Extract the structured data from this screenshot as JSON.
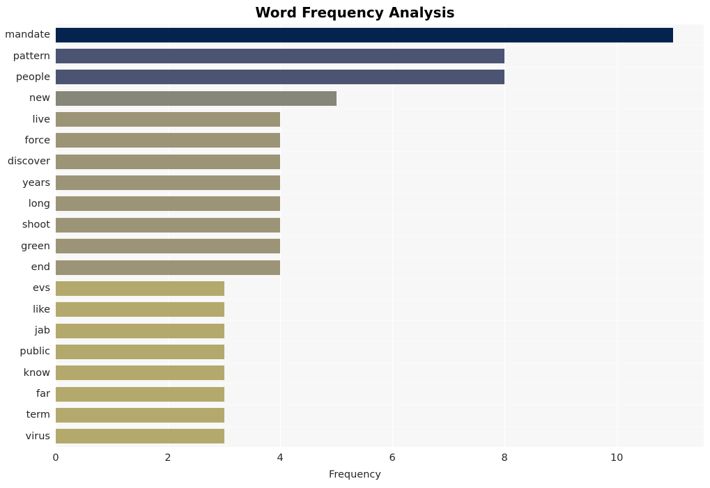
{
  "chart_data": {
    "type": "bar",
    "orientation": "horizontal",
    "title": "Word Frequency Analysis",
    "xlabel": "Frequency",
    "ylabel": "",
    "xlim": [
      0,
      11.55
    ],
    "xticks": [
      0,
      2,
      4,
      6,
      8,
      10
    ],
    "xticklabels": [
      "0",
      "2",
      "4",
      "6",
      "8",
      "10"
    ],
    "grid": true,
    "legend": null,
    "categories": [
      "mandate",
      "pattern",
      "people",
      "new",
      "live",
      "force",
      "discover",
      "years",
      "long",
      "shoot",
      "green",
      "end",
      "evs",
      "like",
      "jab",
      "public",
      "know",
      "far",
      "term",
      "virus"
    ],
    "values": [
      11,
      8,
      8,
      5,
      4,
      4,
      4,
      4,
      4,
      4,
      4,
      4,
      3,
      3,
      3,
      3,
      3,
      3,
      3,
      3
    ],
    "bar_colors": [
      "#04234e",
      "#4b5472",
      "#4b5472",
      "#878779",
      "#9c9476",
      "#9c9476",
      "#9c9476",
      "#9c9476",
      "#9c9476",
      "#9c9476",
      "#9c9476",
      "#9c9476",
      "#b4a96c",
      "#b4a96c",
      "#b4a96c",
      "#b4a96c",
      "#b4a96c",
      "#b4a96c",
      "#b4a96c",
      "#b4a96c"
    ],
    "plot_background": "#f7f7f7",
    "figure_background": "#ffffff",
    "tick_color": "#262626"
  }
}
